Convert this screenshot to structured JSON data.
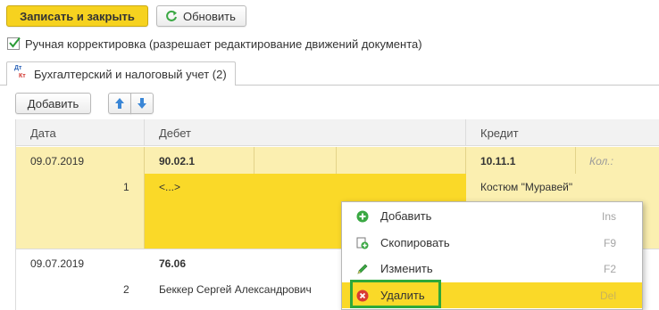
{
  "toolbar": {
    "save_close_label": "Записать и закрыть",
    "refresh_label": "Обновить"
  },
  "manual_correction": {
    "checked": true,
    "label": "Ручная корректировка (разрешает редактирование движений документа)"
  },
  "tab": {
    "icon_top": "Дт",
    "icon_bottom": "Кт",
    "label": "Бухгалтерский и налоговый учет (2)"
  },
  "grid_toolbar": {
    "add_label": "Добавить",
    "up_icon": "arrow-up-icon",
    "down_icon": "arrow-down-icon"
  },
  "grid": {
    "headers": [
      "Дата",
      "Дебет",
      "Кредит"
    ],
    "rows": [
      {
        "date": "09.07.2019",
        "debit": "90.02.1",
        "credit": "10.11.1",
        "credit_extra": "Кол.:",
        "number": "1",
        "debit_sub": "<...>",
        "credit_sub": "Костюм \"Муравей\""
      },
      {
        "date": "09.07.2019",
        "debit": "76.06",
        "number": "2",
        "debit_sub": "Беккер Сергей Александрович"
      }
    ]
  },
  "context_menu": {
    "items": [
      {
        "label": "Добавить",
        "shortcut": "Ins",
        "icon": "plus-circle-icon"
      },
      {
        "label": "Скопировать",
        "shortcut": "F9",
        "icon": "copy-icon"
      },
      {
        "label": "Изменить",
        "shortcut": "F2",
        "icon": "pencil-icon"
      },
      {
        "label": "Удалить",
        "shortcut": "Del",
        "icon": "delete-circle-icon"
      }
    ],
    "active_index": 3
  },
  "colors": {
    "accent_yellow": "#f6d21f",
    "selected_row": "#fbefb0",
    "highlight_box": "#2ea83a"
  }
}
